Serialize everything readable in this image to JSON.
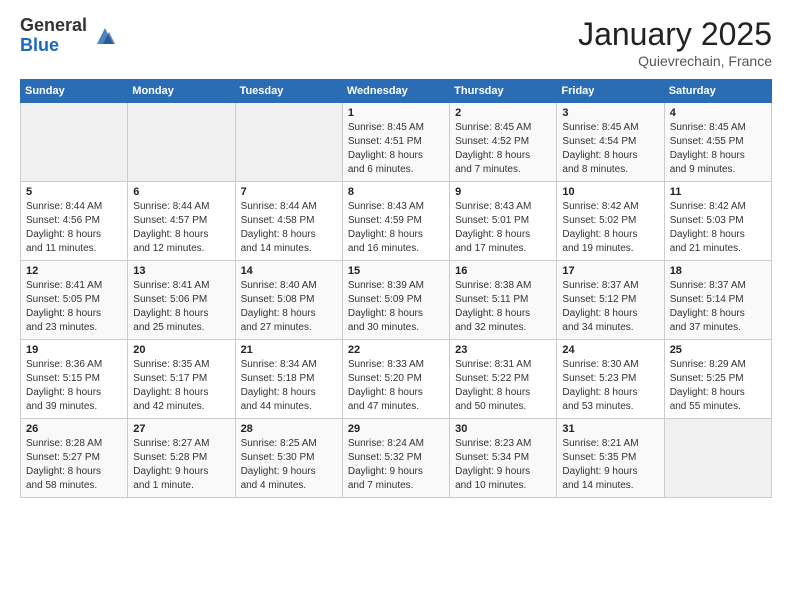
{
  "logo": {
    "general": "General",
    "blue": "Blue"
  },
  "title": "January 2025",
  "location": "Quievrechain, France",
  "days_header": [
    "Sunday",
    "Monday",
    "Tuesday",
    "Wednesday",
    "Thursday",
    "Friday",
    "Saturday"
  ],
  "weeks": [
    [
      {
        "day": "",
        "info": ""
      },
      {
        "day": "",
        "info": ""
      },
      {
        "day": "",
        "info": ""
      },
      {
        "day": "1",
        "info": "Sunrise: 8:45 AM\nSunset: 4:51 PM\nDaylight: 8 hours\nand 6 minutes."
      },
      {
        "day": "2",
        "info": "Sunrise: 8:45 AM\nSunset: 4:52 PM\nDaylight: 8 hours\nand 7 minutes."
      },
      {
        "day": "3",
        "info": "Sunrise: 8:45 AM\nSunset: 4:54 PM\nDaylight: 8 hours\nand 8 minutes."
      },
      {
        "day": "4",
        "info": "Sunrise: 8:45 AM\nSunset: 4:55 PM\nDaylight: 8 hours\nand 9 minutes."
      }
    ],
    [
      {
        "day": "5",
        "info": "Sunrise: 8:44 AM\nSunset: 4:56 PM\nDaylight: 8 hours\nand 11 minutes."
      },
      {
        "day": "6",
        "info": "Sunrise: 8:44 AM\nSunset: 4:57 PM\nDaylight: 8 hours\nand 12 minutes."
      },
      {
        "day": "7",
        "info": "Sunrise: 8:44 AM\nSunset: 4:58 PM\nDaylight: 8 hours\nand 14 minutes."
      },
      {
        "day": "8",
        "info": "Sunrise: 8:43 AM\nSunset: 4:59 PM\nDaylight: 8 hours\nand 16 minutes."
      },
      {
        "day": "9",
        "info": "Sunrise: 8:43 AM\nSunset: 5:01 PM\nDaylight: 8 hours\nand 17 minutes."
      },
      {
        "day": "10",
        "info": "Sunrise: 8:42 AM\nSunset: 5:02 PM\nDaylight: 8 hours\nand 19 minutes."
      },
      {
        "day": "11",
        "info": "Sunrise: 8:42 AM\nSunset: 5:03 PM\nDaylight: 8 hours\nand 21 minutes."
      }
    ],
    [
      {
        "day": "12",
        "info": "Sunrise: 8:41 AM\nSunset: 5:05 PM\nDaylight: 8 hours\nand 23 minutes."
      },
      {
        "day": "13",
        "info": "Sunrise: 8:41 AM\nSunset: 5:06 PM\nDaylight: 8 hours\nand 25 minutes."
      },
      {
        "day": "14",
        "info": "Sunrise: 8:40 AM\nSunset: 5:08 PM\nDaylight: 8 hours\nand 27 minutes."
      },
      {
        "day": "15",
        "info": "Sunrise: 8:39 AM\nSunset: 5:09 PM\nDaylight: 8 hours\nand 30 minutes."
      },
      {
        "day": "16",
        "info": "Sunrise: 8:38 AM\nSunset: 5:11 PM\nDaylight: 8 hours\nand 32 minutes."
      },
      {
        "day": "17",
        "info": "Sunrise: 8:37 AM\nSunset: 5:12 PM\nDaylight: 8 hours\nand 34 minutes."
      },
      {
        "day": "18",
        "info": "Sunrise: 8:37 AM\nSunset: 5:14 PM\nDaylight: 8 hours\nand 37 minutes."
      }
    ],
    [
      {
        "day": "19",
        "info": "Sunrise: 8:36 AM\nSunset: 5:15 PM\nDaylight: 8 hours\nand 39 minutes."
      },
      {
        "day": "20",
        "info": "Sunrise: 8:35 AM\nSunset: 5:17 PM\nDaylight: 8 hours\nand 42 minutes."
      },
      {
        "day": "21",
        "info": "Sunrise: 8:34 AM\nSunset: 5:18 PM\nDaylight: 8 hours\nand 44 minutes."
      },
      {
        "day": "22",
        "info": "Sunrise: 8:33 AM\nSunset: 5:20 PM\nDaylight: 8 hours\nand 47 minutes."
      },
      {
        "day": "23",
        "info": "Sunrise: 8:31 AM\nSunset: 5:22 PM\nDaylight: 8 hours\nand 50 minutes."
      },
      {
        "day": "24",
        "info": "Sunrise: 8:30 AM\nSunset: 5:23 PM\nDaylight: 8 hours\nand 53 minutes."
      },
      {
        "day": "25",
        "info": "Sunrise: 8:29 AM\nSunset: 5:25 PM\nDaylight: 8 hours\nand 55 minutes."
      }
    ],
    [
      {
        "day": "26",
        "info": "Sunrise: 8:28 AM\nSunset: 5:27 PM\nDaylight: 8 hours\nand 58 minutes."
      },
      {
        "day": "27",
        "info": "Sunrise: 8:27 AM\nSunset: 5:28 PM\nDaylight: 9 hours\nand 1 minute."
      },
      {
        "day": "28",
        "info": "Sunrise: 8:25 AM\nSunset: 5:30 PM\nDaylight: 9 hours\nand 4 minutes."
      },
      {
        "day": "29",
        "info": "Sunrise: 8:24 AM\nSunset: 5:32 PM\nDaylight: 9 hours\nand 7 minutes."
      },
      {
        "day": "30",
        "info": "Sunrise: 8:23 AM\nSunset: 5:34 PM\nDaylight: 9 hours\nand 10 minutes."
      },
      {
        "day": "31",
        "info": "Sunrise: 8:21 AM\nSunset: 5:35 PM\nDaylight: 9 hours\nand 14 minutes."
      },
      {
        "day": "",
        "info": ""
      }
    ]
  ]
}
